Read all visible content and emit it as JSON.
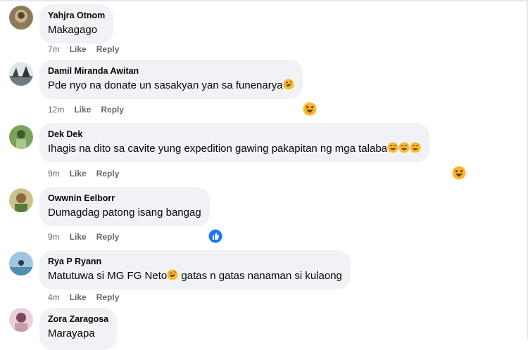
{
  "comments": [
    {
      "author": "Yahjra Otnom",
      "text": "Makagago",
      "time": "7m",
      "like": "Like",
      "reply": "Reply"
    },
    {
      "author": "Damil Miranda Awitan",
      "text": "Pde nyo na donate un sasakyan yan sa funenarya",
      "time": "12m",
      "like": "Like",
      "reply": "Reply",
      "reaction": "haha-reaction-icon"
    },
    {
      "author": "Dek Dek",
      "text": "Ihagis na dito sa cavite yung expedition gawing pakapitan ng mga talaba",
      "time": "9m",
      "like": "Like",
      "reply": "Reply",
      "reaction": "haha-reaction-icon"
    },
    {
      "author": "Owwnin Eelborr",
      "text": "Dumagdag patong isang bangag",
      "time": "9m",
      "like": "Like",
      "reply": "Reply",
      "reaction": "like-reaction-icon"
    },
    {
      "author": "Rya P Ryann",
      "text_before": "Matutuwa si MG FG Neto",
      "text_after": " gatas n gatas nanaman si kulaong",
      "time": "4m",
      "like": "Like",
      "reply": "Reply"
    },
    {
      "author": "Zora Zaragosa",
      "text": "Marayapa"
    }
  ],
  "colors": {
    "bubble": "#f0f2f5",
    "meta": "#65676b",
    "text": "#050505",
    "like_blue": "#1877f2",
    "emoji_yellow": "#f7b928"
  }
}
